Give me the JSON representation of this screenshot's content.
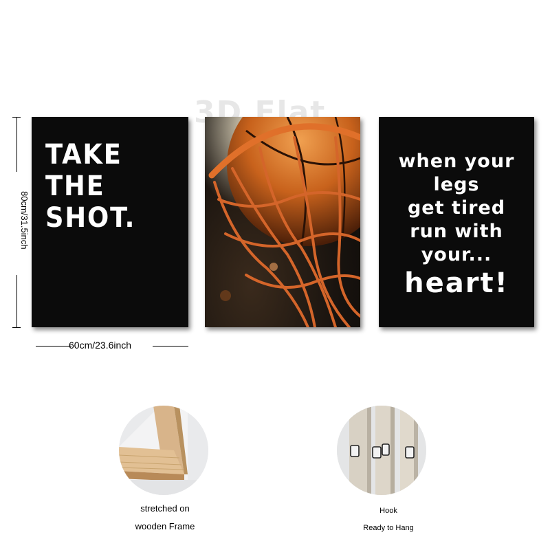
{
  "watermark": "3D Flat",
  "panels": {
    "left": {
      "lines": [
        "TAKE",
        "THE",
        "SHOT."
      ]
    },
    "right": {
      "lines": [
        "when your",
        "legs",
        "get tired",
        "run with",
        "your..."
      ],
      "emphasis": "heart!"
    }
  },
  "dimensions": {
    "height": "80cm/31.5inch",
    "width": "60cm/23.6inch"
  },
  "features": {
    "frame": {
      "line1": "stretched on",
      "line2": "wooden Frame"
    },
    "hook": {
      "line1": "Hook",
      "line2": "Ready to Hang"
    }
  },
  "colors": {
    "panel_background": "#0b0b0b",
    "text": "#ffffff",
    "basketball_orange": "#c8621c",
    "rim_orange": "#e0702a"
  }
}
